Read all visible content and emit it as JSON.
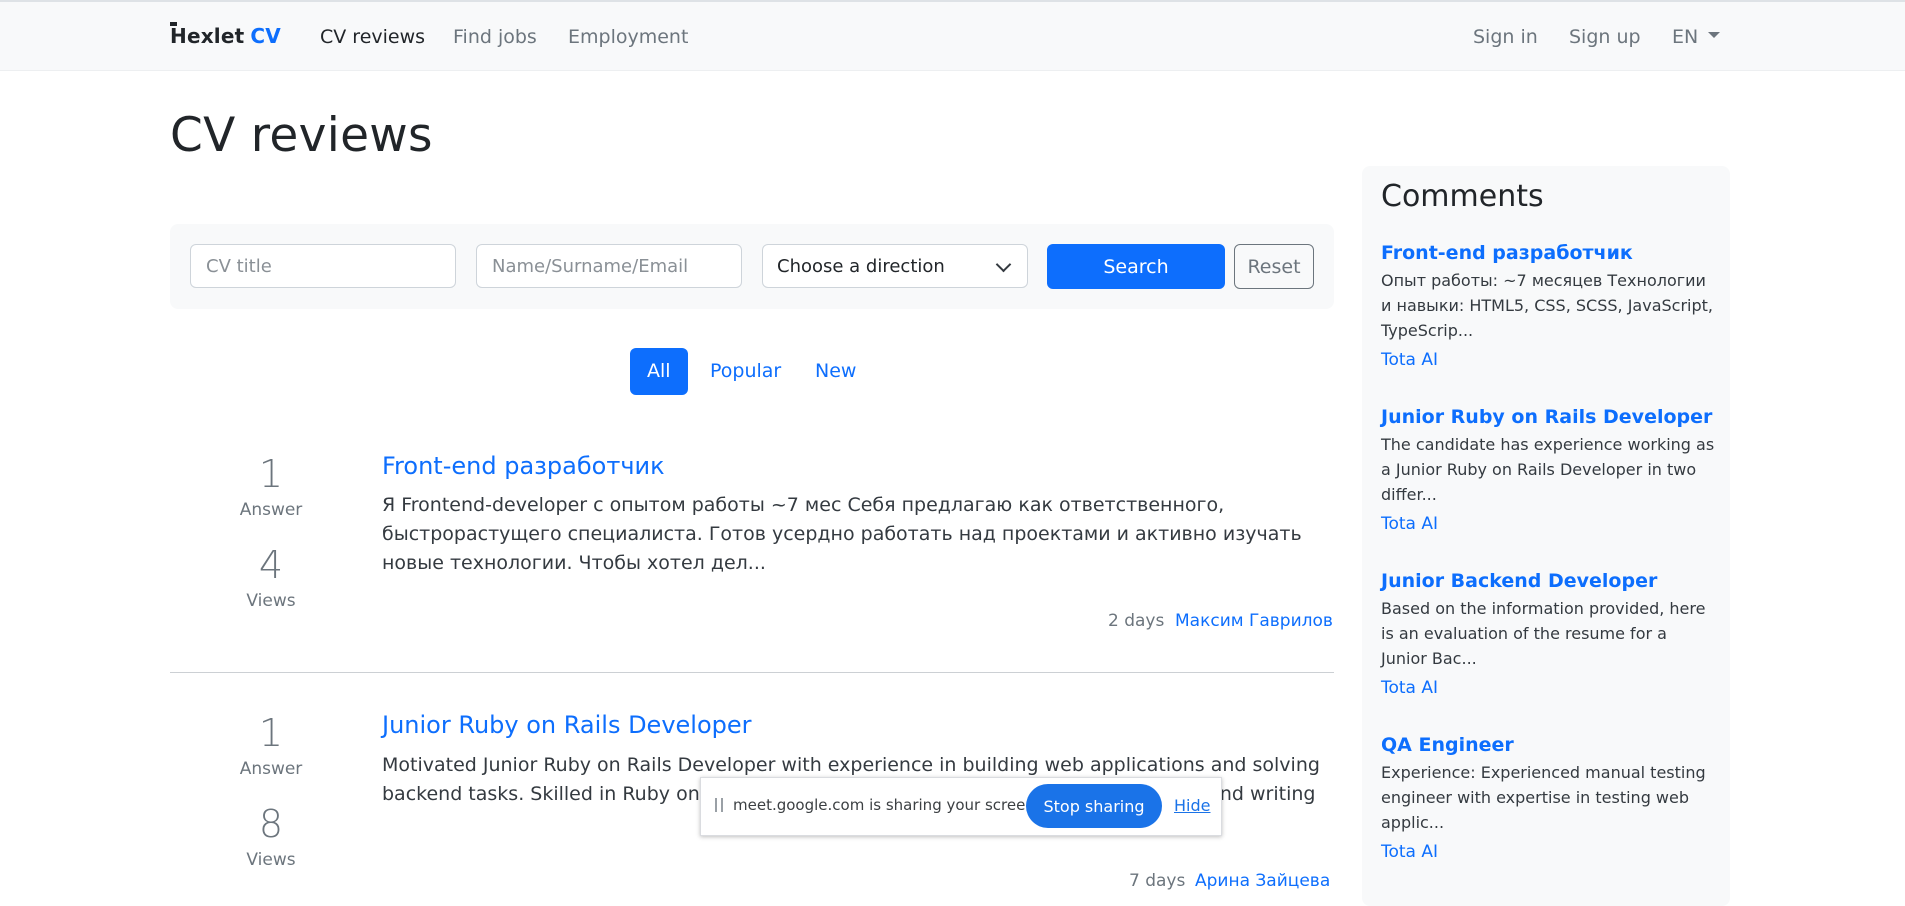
{
  "navbar": {
    "brand_name": "Hexlet",
    "brand_suffix": "CV",
    "links": [
      "CV reviews",
      "Find jobs",
      "Employment"
    ],
    "sign_in": "Sign in",
    "sign_up": "Sign up",
    "language": "EN"
  },
  "page": {
    "title": "CV reviews"
  },
  "search": {
    "title_placeholder": "CV title",
    "name_placeholder": "Name/Surname/Email",
    "direction_value": "Choose a direction",
    "search_label": "Search",
    "reset_label": "Reset"
  },
  "filters": [
    "All",
    "Popular",
    "New"
  ],
  "reviews": [
    {
      "answers": "1",
      "answers_label": "Answer",
      "views": "4",
      "views_label": "Views",
      "title": "Front-end разработчик",
      "text": "Я Frontend-developer с опытом работы ~7 мес Себя предлагаю как ответственного, быстрорастущего специалиста. Готов усердно работать над проектами и активно изучать новые технологии. Чтобы хотел дел...",
      "age": "2 days",
      "author": "Максим Гаврилов"
    },
    {
      "answers": "1",
      "answers_label": "Answer",
      "views": "8",
      "views_label": "Views",
      "title": "Junior Ruby on Rails Developer",
      "text": "Motivated Junior Ruby on Rails Developer with experience in building web applications and solving backend tasks. Skilled in Ruby on Rails, REST, MVC, and service-oriented architecture, and writing",
      "age": "7 days",
      "author": "Арина Зайцева"
    }
  ],
  "comments": {
    "title": "Comments",
    "items": [
      {
        "title": "Front-end разработчик",
        "text": "Опыт работы: ~7 месяцев Технологии и навыки: HTML5, CSS, SCSS, JavaScript, TypeScrip...",
        "author": "Tota AI"
      },
      {
        "title": "Junior Ruby on Rails Developer",
        "text": "The candidate has experience working as a Junior Ruby on Rails Developer in two differ...",
        "author": "Tota AI"
      },
      {
        "title": "Junior Backend Developer",
        "text": "Based on the information provided, here is an evaluation of the resume for a Junior Bac...",
        "author": "Tota AI"
      },
      {
        "title": "QA Engineer",
        "text": "Experience: Experienced manual testing engineer with expertise in testing web applic...",
        "author": "Tota AI"
      }
    ]
  },
  "screen_share": {
    "message": "meet.google.com is sharing your screen.",
    "stop_label": "Stop sharing",
    "hide_label": "Hide"
  },
  "colors": {
    "accent": "#0d6efd",
    "muted": "#6c757d",
    "navbar_bg": "#f8f9fa"
  }
}
